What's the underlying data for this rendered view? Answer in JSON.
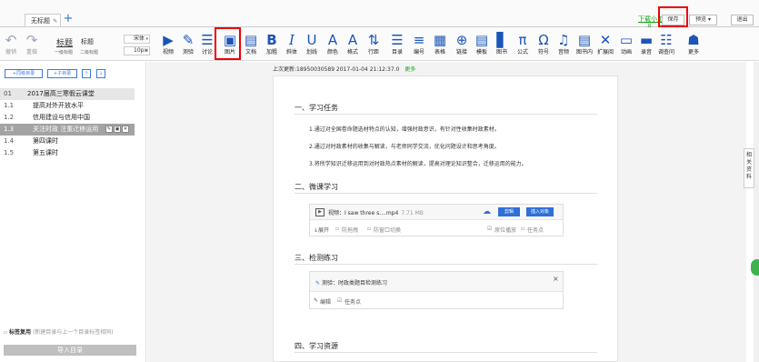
{
  "tabs": {
    "active_label": "无标题",
    "add_label": "+"
  },
  "topbar": {
    "download_label": "下载小工",
    "download_sub": "具",
    "save_label": "保存",
    "preview_label": "预览 ▾",
    "exit_label": "退出"
  },
  "toolbar": {
    "undo_label": "撤销",
    "redo_label": "重做",
    "heading1": "标题",
    "heading2": "标题",
    "heading1_sub": "一级标题",
    "heading2_sub": "二级标题",
    "font_family": "宋体",
    "font_size": "10px",
    "items": [
      {
        "label": "视频",
        "icon": "video-icon"
      },
      {
        "label": "测验",
        "icon": "quiz-icon"
      },
      {
        "label": "讨论",
        "icon": "discuss-icon"
      },
      {
        "label": "图片",
        "icon": "image-icon"
      },
      {
        "label": "文档",
        "icon": "document-icon"
      },
      {
        "label": "加粗",
        "icon": "bold-icon"
      },
      {
        "label": "斜体",
        "icon": "italic-icon"
      },
      {
        "label": "划线",
        "icon": "underline-icon"
      },
      {
        "label": "颜色",
        "icon": "color-icon"
      },
      {
        "label": "格式",
        "icon": "format-icon"
      },
      {
        "label": "行距",
        "icon": "line-spacing-icon"
      },
      {
        "label": "目录",
        "icon": "toc-icon"
      },
      {
        "label": "编号",
        "icon": "numbering-icon"
      },
      {
        "label": "表格",
        "icon": "table-icon"
      },
      {
        "label": "链接",
        "icon": "link-icon"
      },
      {
        "label": "模板",
        "icon": "template-icon"
      },
      {
        "label": "图书",
        "icon": "book-icon"
      },
      {
        "label": "公式",
        "icon": "formula-icon"
      },
      {
        "label": "符号",
        "icon": "symbol-icon"
      },
      {
        "label": "音频",
        "icon": "audio-icon"
      },
      {
        "label": "图书内",
        "icon": "book-inner-icon"
      },
      {
        "label": "扩展阅",
        "icon": "extended-reading-icon"
      },
      {
        "label": "动画",
        "icon": "animation-icon"
      },
      {
        "label": "录音",
        "icon": "record-icon"
      },
      {
        "label": "调查问",
        "icon": "survey-icon"
      },
      {
        "label": "更多",
        "icon": "more-icon"
      }
    ]
  },
  "sidebar": {
    "add_same_label": "+同级目录",
    "add_child_label": "+子目录",
    "up_label": "↑",
    "down_label": "↓",
    "toc": [
      {
        "num": "01",
        "label": "2017届高三寒假云课堂",
        "state": "header"
      },
      {
        "num": "1.1",
        "label": "提高对外开放水平",
        "state": ""
      },
      {
        "num": "1.2",
        "label": "信用建设与信用中国",
        "state": ""
      },
      {
        "num": "1.3",
        "label": "关注时政 注重迁移运用",
        "state": "active"
      },
      {
        "num": "1.4",
        "label": "第四课时",
        "state": ""
      },
      {
        "num": "1.5",
        "label": "第五课时",
        "state": ""
      }
    ],
    "tag_reuse_label": "标签复用",
    "tag_reuse_hint": "(新建目录与上一个目录标签相同)",
    "import_label": "导入目录"
  },
  "document": {
    "last_update": "上次更新:18950030589 2017-01-04 21:12:37.0",
    "more_label": "更多",
    "sections": {
      "s1": "一、学习任务",
      "s2": "二、微课学习",
      "s3": "三、检测练习",
      "s4": "四、学习资源"
    },
    "tasks": [
      "1.通过对全国卷命题选材特点的认知，增强时政意识，有针对性收集时政素材。",
      "2.通过对时政素材的收集与解读，与老师同学交流，优化问题设计和思考角度。",
      "3.将所学知识迁移运用到对时政热点素材的解读，提高对理论知识整合，迁移运用的能力。"
    ],
    "video": {
      "name": "视频：I saw three s....mp4",
      "size": "7.71 MB",
      "edit_label": "剪辑",
      "insert_label": "插入对象",
      "opt_expand": "↓展开",
      "opt_antidrag": "防拖拽",
      "opt_antiwindow": "防窗口切换",
      "opt_origin_speed": "原位播放",
      "opt_taskpoint": "任务点"
    },
    "quiz": {
      "name": "测验：时政类题目检测练习",
      "edit_label": "编辑",
      "taskpoint_label": "任务点",
      "close_label": "×"
    }
  },
  "right_tab_label": "相关资料"
}
